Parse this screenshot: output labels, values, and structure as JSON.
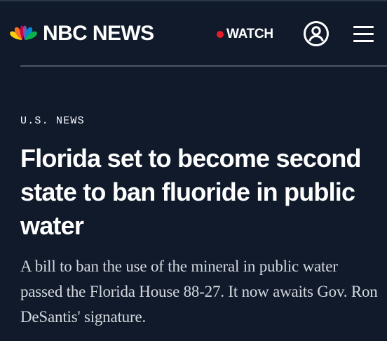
{
  "header": {
    "brand": "NBC NEWS",
    "logo_icon": "nbc-peacock-icon",
    "watch_label": "WATCH",
    "live_dot_color": "#e41b2a",
    "account_icon": "user-account-icon",
    "menu_icon": "hamburger-menu-icon"
  },
  "article": {
    "section": "U.S. NEWS",
    "headline": "Florida set to become second state to ban fluoride in public water",
    "dek": "A bill to ban the use of the mineral in public water passed the Florida House 88-27. It now awaits Gov. Ron DeSantis' signature."
  },
  "colors": {
    "background": "#101a2b",
    "text": "#ffffff",
    "dek_text": "#d3d7dd",
    "divider": "#4c5667"
  }
}
